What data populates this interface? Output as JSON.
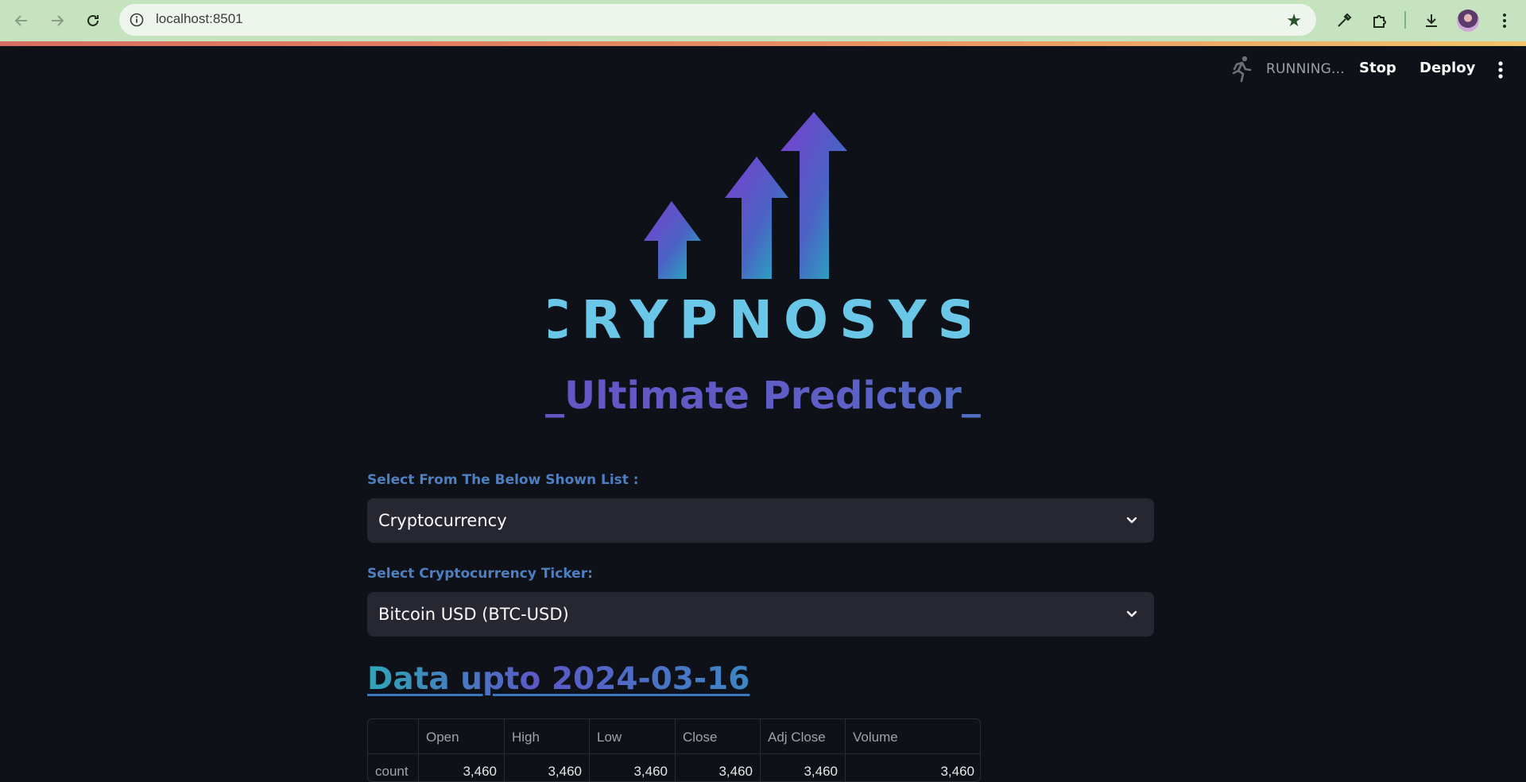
{
  "browser": {
    "url": "localhost:8501",
    "icons": {
      "back": "arrow-left-icon",
      "forward": "arrow-right-icon",
      "reload": "reload-icon",
      "site_info": "info-icon",
      "bookmark": "star-icon",
      "eyedropper": "eyedropper-icon",
      "extensions": "puzzle-icon",
      "downloads": "download-icon",
      "menu": "kebab-menu-icon"
    },
    "colors": {
      "toolbar": "#c5e3bf",
      "address_bar": "#eef5ec"
    }
  },
  "header": {
    "status": "RUNNING...",
    "stop_label": "Stop",
    "deploy_label": "Deploy"
  },
  "logo": {
    "wordmark": "CRYPNOSYS"
  },
  "main": {
    "title": "_Ultimate Predictor_",
    "asset_type": {
      "label": "Select From The Below Shown List :",
      "value": "Cryptocurrency"
    },
    "ticker": {
      "label": "Select Cryptocurrency Ticker:",
      "value": "Bitcoin USD (BTC-USD)"
    },
    "data_heading": "Data upto 2024-03-16",
    "table": {
      "columns": [
        "",
        "Open",
        "High",
        "Low",
        "Close",
        "Adj Close",
        "Volume"
      ],
      "rows": [
        [
          "count",
          "3,460",
          "3,460",
          "3,460",
          "3,460",
          "3,460",
          "3,460"
        ]
      ]
    }
  },
  "colors": {
    "background": "#0e1117",
    "label": "#4d7fc1",
    "select_bg": "#262730",
    "accent_teal": "#2fa6b8",
    "accent_purple": "#6a4fc4"
  }
}
